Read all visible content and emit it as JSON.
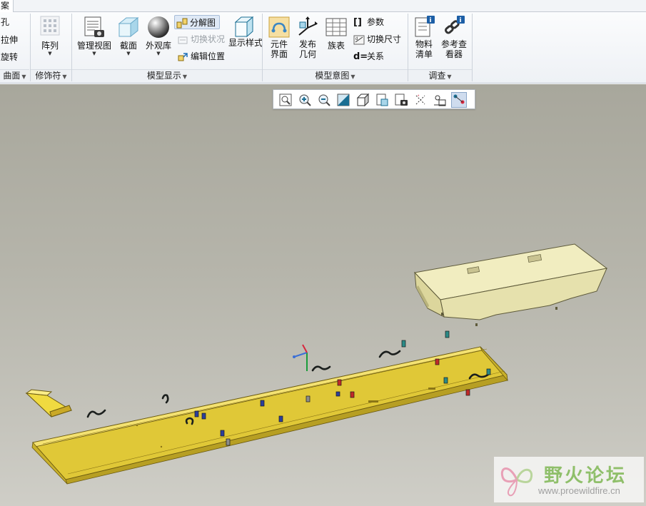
{
  "tabs": {
    "active": "案"
  },
  "ribbon": {
    "left_partial": {
      "hole": "孔",
      "extrude": "拉伸",
      "revolve": "旋转"
    },
    "groups": {
      "surface": "曲面",
      "modifiers": "修饰符",
      "model_display": "模型显示",
      "model_intent": "模型意图",
      "investigate": "调查"
    },
    "buttons": {
      "pattern": "阵列",
      "manage_views": "管理视图",
      "section": "截面",
      "appearance_gallery": "外观库",
      "explode_view": "分解图",
      "toggle_status": "切换状况",
      "edit_position": "编辑位置",
      "display_style": "显示样式",
      "component_interface": [
        "元件",
        "界面"
      ],
      "publish_geometry": [
        "发布",
        "几何"
      ],
      "family_table": "族表",
      "parameters": "参数",
      "switch_dimensions": "切换尺寸",
      "relations": "关系",
      "bom": [
        "物料",
        "清单"
      ],
      "reference_viewer": [
        "参考查",
        "看器"
      ]
    }
  },
  "view_toolbar": {
    "buttons": [
      "refit-icon",
      "zoom-in-icon",
      "zoom-out-icon",
      "repaint-icon",
      "display-style-icon",
      "saved-orientations-icon",
      "view-manager-icon",
      "datum-display-icon",
      "spin-center-icon",
      "annotation-display-icon"
    ],
    "active": "annotation-display-icon"
  },
  "watermark": {
    "title": "野火论坛",
    "url": "www.proewildfire.cn"
  },
  "colors": {
    "viewport_top": "#a8a79c",
    "part_yellow": "#e3cc3c",
    "cover_cream": "#eeeab8",
    "ribbon_bg": "#eef1f5",
    "accent_green": "#8fbf6a"
  }
}
